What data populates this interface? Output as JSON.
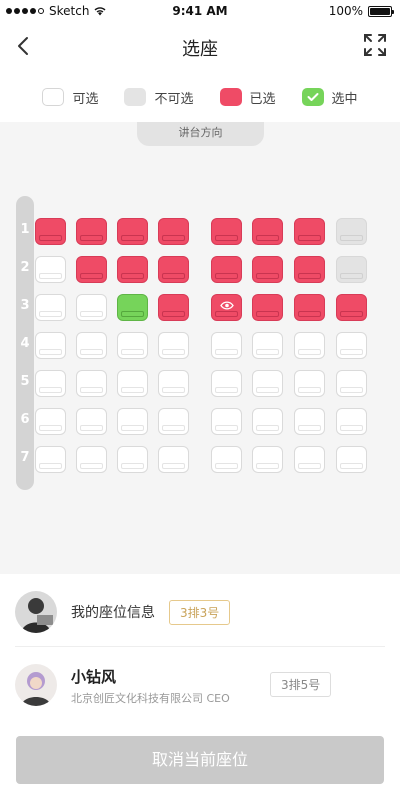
{
  "status_bar": {
    "carrier": "Sketch",
    "time": "9:41 AM",
    "battery": "100%"
  },
  "nav": {
    "title": "选座"
  },
  "legend": [
    {
      "label": "可选",
      "kind": "available"
    },
    {
      "label": "不可选",
      "kind": "unavailable"
    },
    {
      "label": "已选",
      "kind": "sold"
    },
    {
      "label": "选中",
      "kind": "selected"
    }
  ],
  "stage_label": "讲台方向",
  "row_numbers": [
    "1",
    "2",
    "3",
    "4",
    "5",
    "6",
    "7"
  ],
  "seat_rows": [
    [
      "sold",
      "sold",
      "sold",
      "sold",
      "sold",
      "sold",
      "sold",
      "unavailable"
    ],
    [
      "available",
      "sold",
      "sold",
      "sold",
      "sold",
      "sold",
      "sold",
      "unavailable"
    ],
    [
      "available",
      "available",
      "selected",
      "sold",
      "sold-viewing",
      "sold",
      "sold",
      "sold"
    ],
    [
      "available",
      "available",
      "available",
      "available",
      "available",
      "available",
      "available",
      "available"
    ],
    [
      "available",
      "available",
      "available",
      "available",
      "available",
      "available",
      "available",
      "available"
    ],
    [
      "available",
      "available",
      "available",
      "available",
      "available",
      "available",
      "available",
      "available"
    ],
    [
      "available",
      "available",
      "available",
      "available",
      "available",
      "available",
      "available",
      "available"
    ]
  ],
  "my_seat": {
    "label": "我的座位信息",
    "seat": "3排3号"
  },
  "other_user": {
    "name": "小钻风",
    "company": "北京创匠文化科技有限公司 CEO",
    "seat": "3排5号"
  },
  "cancel_button": "取消当前座位",
  "colors": {
    "sold": "#ef4b66",
    "selected": "#76d45a",
    "unavailable": "#e3e3e3",
    "accent_gold": "#c9a35a"
  }
}
